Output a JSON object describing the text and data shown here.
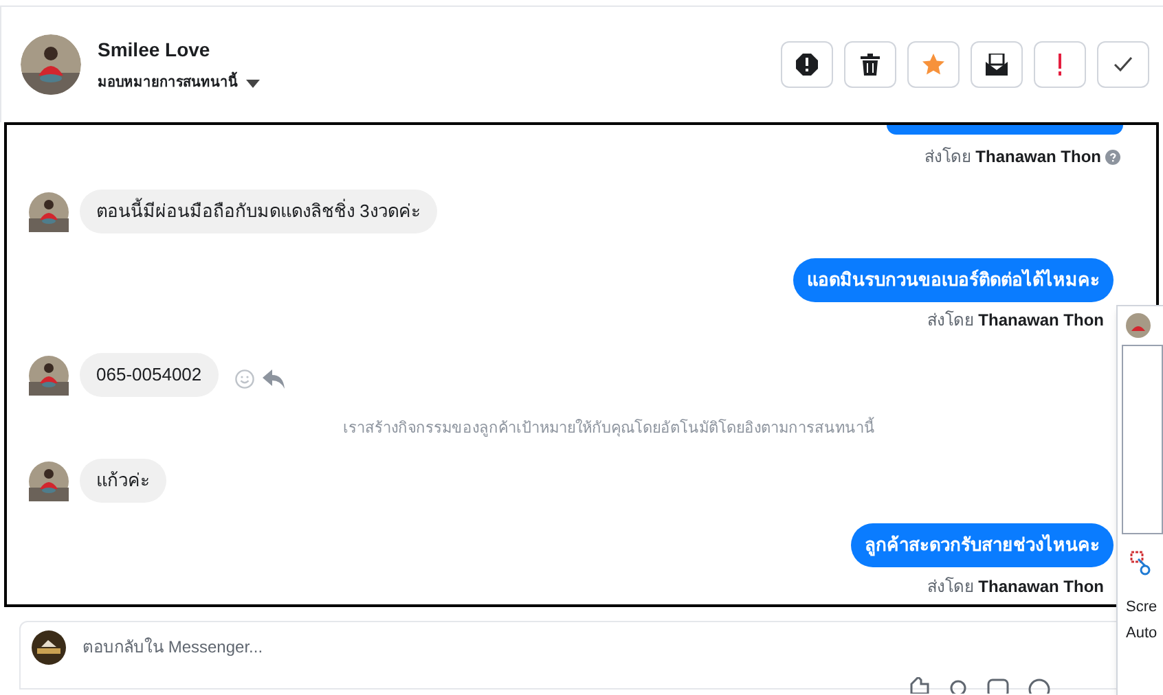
{
  "contact": {
    "name": "Smilee Love",
    "assign_label": "มอบหมายการสนทนานี้"
  },
  "actions": [
    {
      "kind": "alert"
    },
    {
      "kind": "trash"
    },
    {
      "kind": "star"
    },
    {
      "kind": "inbox"
    },
    {
      "kind": "important"
    },
    {
      "kind": "done"
    }
  ],
  "messages": [
    {
      "kind": "sent-cut",
      "sender_prefix": "ส่งโดย",
      "sender": "Thanawan Thon",
      "info": true
    },
    {
      "kind": "received",
      "text": "ตอนนี้มีผ่อนมือถือกับมดแดงลิชชิ่ง 3งวดค่ะ",
      "reactions": false
    },
    {
      "kind": "sent",
      "text": "แอดมินรบกวนขอเบอร์ติดต่อได้ไหมคะ",
      "sender_prefix": "ส่งโดย",
      "sender": "Thanawan Thon",
      "info": false
    },
    {
      "kind": "received",
      "text": "065-0054002",
      "reactions": true
    },
    {
      "kind": "system",
      "text": "เราสร้างกิจกรรมของลูกค้าเป้าหมายให้กับคุณโดยอัตโนมัติโดยอิงตามการสนทนานี้"
    },
    {
      "kind": "received",
      "text": "แก้วค่ะ",
      "reactions": false
    },
    {
      "kind": "sent",
      "text": "ลูกค้าสะดวกรับสายช่วงไหนคะ",
      "sender_prefix": "ส่งโดย",
      "sender": "Thanawan Thon",
      "info": false
    }
  ],
  "composer": {
    "placeholder": "ตอบกลับใน Messenger..."
  },
  "popup": {
    "lines": [
      "Scre",
      "Auto"
    ]
  }
}
